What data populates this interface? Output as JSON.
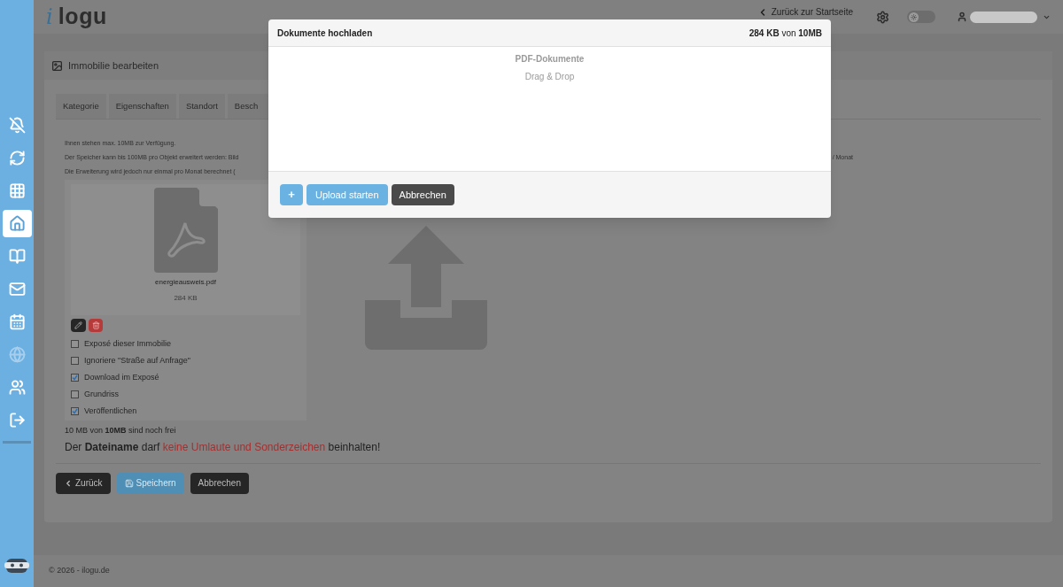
{
  "header": {
    "logo_mark": "i",
    "logo_text": "logu",
    "back_link": "Zurück zur Startseite",
    "theme_toggle": {
      "on": false
    }
  },
  "sidebar": {
    "items": [
      {
        "selected": false,
        "disabled": false
      },
      {
        "selected": false,
        "disabled": false
      },
      {
        "selected": false,
        "disabled": false
      },
      {
        "selected": true,
        "disabled": false
      },
      {
        "selected": false,
        "disabled": false
      },
      {
        "selected": false,
        "disabled": false
      },
      {
        "selected": false,
        "disabled": false
      },
      {
        "selected": false,
        "disabled": true
      },
      {
        "selected": false,
        "disabled": false
      },
      {
        "selected": false,
        "disabled": false
      }
    ]
  },
  "panel": {
    "title": "Immobilie bearbeiten",
    "tabs": [
      {
        "label": "Kategorie",
        "selected": false
      },
      {
        "label": "Eigenschaften",
        "selected": false
      },
      {
        "label": "Standort",
        "selected": false
      },
      {
        "label": "Besch",
        "selected": false
      }
    ],
    "info_lines": [
      {
        "left": "Ihnen stehen max. 10MB zur Verfügung."
      },
      {
        "left": "Der Speicher kann bis 100MB pro Objekt erweitert werden: Bild",
        "right": "/ Monat"
      },
      {
        "left": "Die Erweiterung wird jedoch nur einmal pro Monat berechnet ("
      }
    ],
    "file": {
      "name": "energieausweis.pdf",
      "size": "284 KB",
      "options": [
        {
          "label": "Exposé dieser Immobilie",
          "checked": false
        },
        {
          "label": "Ignoriere \"Straße auf Anfrage\"",
          "checked": false
        },
        {
          "label": "Download im Exposé",
          "checked": true
        },
        {
          "label": "Grundriss",
          "checked": false
        },
        {
          "label": "Veröffentlichen",
          "checked": true
        }
      ]
    },
    "storage_note": "10 MB von **10MB** sind noch frei",
    "warning": {
      "before": "Der **Dateiname** darf",
      "highlight": "keine Umlaute und Sonderzeichen",
      "after": "beinhalten!"
    },
    "buttons": [
      {
        "kind": "back",
        "label": "Zurück"
      },
      {
        "kind": "save",
        "label": "Speichern"
      },
      {
        "kind": "cancel",
        "label": "Abbrechen"
      }
    ]
  },
  "footer": "© 2026 - ilogu.de",
  "modal": {
    "title": "Dokumente hochladen",
    "quota": "**284 KB** von **10MB**",
    "drop_title": "PDF-Dokumente",
    "drop_hint": "Drag & Drop",
    "buttons": [
      {
        "kind": "add",
        "label": "+"
      },
      {
        "kind": "start",
        "label": "Upload starten"
      },
      {
        "kind": "cancel",
        "label": "Abbrechen"
      }
    ]
  }
}
